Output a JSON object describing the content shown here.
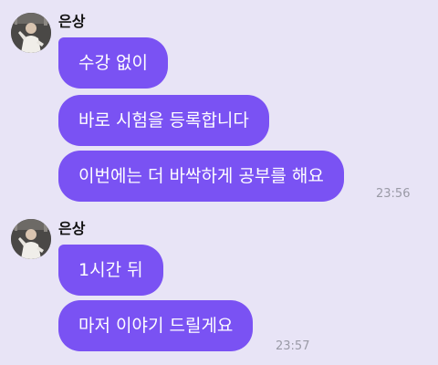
{
  "chat": {
    "groups": [
      {
        "sender": "은상",
        "avatar_icon": "profile-photo",
        "messages": [
          "수강 없이",
          "바로 시험을 등록합니다",
          "이번에는 더 바싹하게 공부를 해요"
        ],
        "time": "23:56"
      },
      {
        "sender": "은상",
        "avatar_icon": "profile-photo",
        "messages": [
          "1시간 뒤",
          "마저 이야기 드릴게요"
        ],
        "time": "23:57"
      }
    ]
  },
  "colors": {
    "background": "#e8e4f6",
    "bubble": "#7a52f3",
    "bubble_text": "#ffffff",
    "timestamp": "#9a9aa6"
  }
}
